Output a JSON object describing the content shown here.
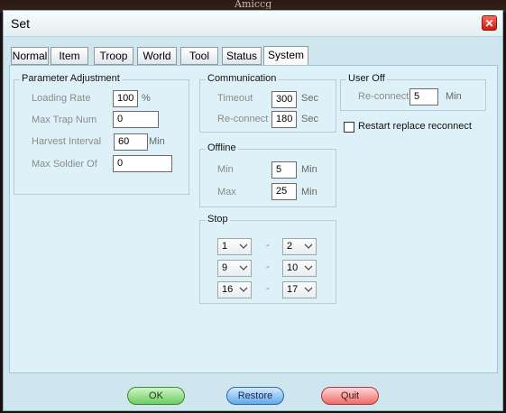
{
  "background_title": "Amiccg",
  "window": {
    "title": "Set",
    "close_glyph": "✕"
  },
  "tabs": [
    {
      "label": "Normal"
    },
    {
      "label": "Item"
    },
    {
      "label": "Troop"
    },
    {
      "label": "World"
    },
    {
      "label": "Tool"
    },
    {
      "label": "Status"
    },
    {
      "label": "System",
      "active": true
    }
  ],
  "param": {
    "title": "Parameter Adjustment",
    "loading_rate": {
      "label": "Loading Rate",
      "value": "100",
      "unit": "%"
    },
    "max_trap": {
      "label": "Max Trap Num",
      "value": "0"
    },
    "harvest": {
      "label": "Harvest Interval",
      "value": "60",
      "unit": "Min"
    },
    "max_soldier": {
      "label": "Max Soldier Of",
      "value": "0"
    }
  },
  "comm": {
    "title": "Communication",
    "timeout": {
      "label": "Timeout",
      "value": "300",
      "unit": "Sec"
    },
    "reconnect": {
      "label": "Re-connect",
      "value": "180",
      "unit": "Sec"
    }
  },
  "useroff": {
    "title": "User Off",
    "reconnect": {
      "label": "Re-connect",
      "value": "5",
      "unit": "Min"
    }
  },
  "restart": {
    "label": "Restart replace reconnect",
    "checked": false
  },
  "offline": {
    "title": "Offline",
    "min": {
      "label": "Min",
      "value": "5",
      "unit": "Min"
    },
    "max": {
      "label": "Max",
      "value": "25",
      "unit": "Min"
    }
  },
  "stop": {
    "title": "Stop",
    "dash": "-",
    "rows": [
      {
        "from": "1",
        "to": "2"
      },
      {
        "from": "9",
        "to": "10"
      },
      {
        "from": "16",
        "to": "17"
      }
    ]
  },
  "buttons": {
    "ok": "OK",
    "restore": "Restore",
    "quit": "Quit"
  },
  "colors": {
    "ok": "#6ccc62",
    "restore": "#60a8ee",
    "quit": "#ee6a6a",
    "panel": "#dff1f8"
  }
}
